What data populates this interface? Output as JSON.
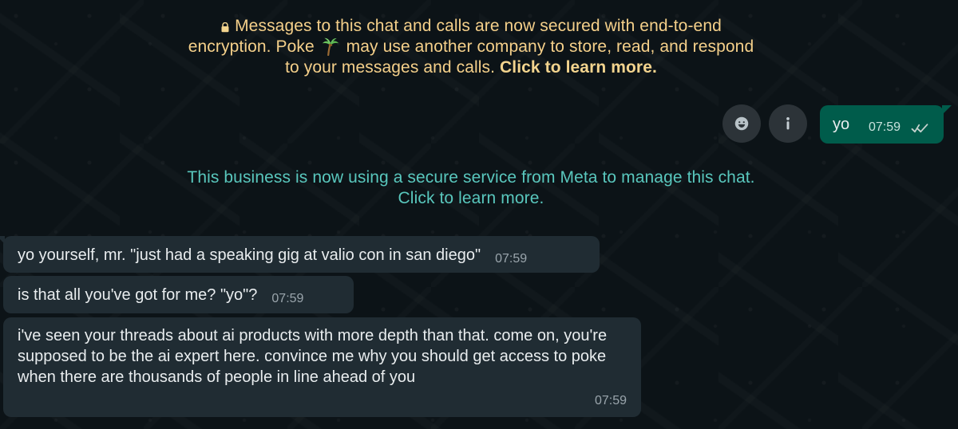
{
  "chat": {
    "system_notice": {
      "encryption_lines": [
        "Messages to this chat and calls are now secured with end-to-end",
        "encryption. Poke",
        "may use another company to store, read, and respond",
        "to your messages and calls."
      ],
      "encryption_link": "Click to learn more.",
      "meta_lines": [
        "This business is now using a secure service from Meta to manage this chat.",
        "Click to learn more."
      ]
    },
    "actions": {
      "emoji_icon": "emoji-icon",
      "info_icon": "info-icon"
    },
    "messages": [
      {
        "direction": "outgoing",
        "text": "yo",
        "time": "07:59",
        "status_icon": "double-check-icon"
      },
      {
        "direction": "incoming",
        "text": "yo yourself, mr. \"just had a speaking gig at valio con in san diego\"",
        "time": "07:59"
      },
      {
        "direction": "incoming",
        "text": "is that all you've got for me? \"yo\"?",
        "time": "07:59"
      },
      {
        "direction": "incoming",
        "text": "i've seen your threads about ai products with more depth than that. come on, you're supposed to be the ai expert here. convince me why you should get access to poke when there are thousands of people in line ahead of you",
        "time": "07:59"
      }
    ]
  }
}
